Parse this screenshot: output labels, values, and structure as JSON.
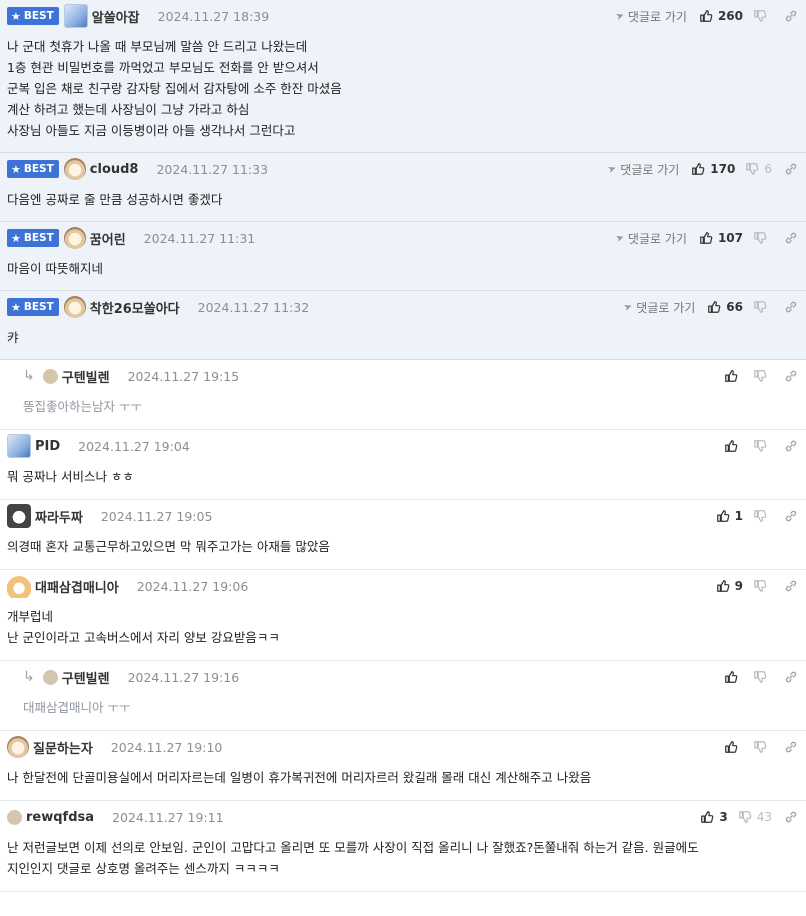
{
  "comments": [
    {
      "best": true,
      "badge": "BEST",
      "avatar": "blue",
      "nick": "알쓸아잡",
      "date": "2024.11.27 18:39",
      "reply_label": "댓글로 가기",
      "up": "260",
      "down": "",
      "lines": [
        "나 군대 첫휴가 나올 때 부모님께 말씀 안 드리고 나왔는데",
        "1층 현관 비밀번호를 까먹었고 부모님도 전화를 안 받으셔서",
        "군복 입은 채로 친구랑 감자탕 집에서 감자탕에 소주 한잔 마셨음",
        "계산 하려고 했는데 사장님이 그냥 가라고 하심",
        "사장님 아들도 지금 이등병이라 아들 생각나서 그런다고"
      ]
    },
    {
      "best": true,
      "badge": "BEST",
      "avatar": "dog",
      "nick": "cloud8",
      "date": "2024.11.27 11:33",
      "reply_label": "댓글로 가기",
      "up": "170",
      "down": "6",
      "lines": [
        "다음엔 공짜로 줄 만큼 성공하시면 좋겠다"
      ]
    },
    {
      "best": true,
      "badge": "BEST",
      "avatar": "dog",
      "nick": "꿈어린",
      "date": "2024.11.27 11:31",
      "reply_label": "댓글로 가기",
      "up": "107",
      "down": "",
      "lines": [
        "마음이 따뜻해지네"
      ]
    },
    {
      "best": true,
      "badge": "BEST",
      "avatar": "dog",
      "nick": "착한26모쏠아다",
      "date": "2024.11.27 11:32",
      "reply_label": "댓글로 가기",
      "up": "66",
      "down": "",
      "lines": [
        "캬"
      ]
    },
    {
      "reply": true,
      "avatar": "dot",
      "nick": "구텐빌렌",
      "date": "2024.11.27 19:15",
      "up": "",
      "down": "",
      "lines": [
        "똥집좋아하는남자 ㅜㅜ"
      ]
    },
    {
      "avatar": "blue",
      "nick": "PID",
      "date": "2024.11.27 19:04",
      "up": "",
      "down": "",
      "lines": [
        "뭐 공짜나 서비스나 ㅎㅎ"
      ]
    },
    {
      "avatar": "dogdark",
      "nick": "짜라두짜",
      "date": "2024.11.27 19:05",
      "up": "1",
      "down": "",
      "lines": [
        "의경때 혼자 교통근무하고있으면 막 뭐주고가는 아재들 많았음"
      ]
    },
    {
      "avatar": "fox",
      "nick": "대패삼겹매니아",
      "date": "2024.11.27 19:06",
      "up": "9",
      "down": "",
      "lines": [
        "개부럽네",
        "난 군인이라고 고속버스에서 자리 양보 강요받음ㅋㅋ"
      ]
    },
    {
      "reply": true,
      "avatar": "dot",
      "nick": "구텐빌렌",
      "date": "2024.11.27 19:16",
      "up": "",
      "down": "",
      "lines": [
        "대패삼겹매니아 ㅜㅜ"
      ]
    },
    {
      "avatar": "dog",
      "nick": "질문하는자",
      "date": "2024.11.27 19:10",
      "up": "",
      "down": "",
      "lines": [
        "나 한달전에 단골미용실에서 머리자르는데 일병이 휴가복귀전에 머리자르러 왔길래 몰래 대신 계산해주고 나왔음"
      ]
    },
    {
      "avatar": "dot",
      "nick": "rewqfdsa",
      "date": "2024.11.27 19:11",
      "up": "3",
      "down": "43",
      "lines": [
        "난 저런글보면 이제 선의로 안보임. 군인이 고맙다고 올리면 또 모를까 사장이 직접 올리니 나 잘했죠?돈쭐내줘 하는거 같음. 원글에도",
        "지인인지 댓글로 상호명 올려주는 센스까지 ㅋㅋㅋㅋ"
      ]
    }
  ],
  "icons": {
    "star": "star-icon",
    "thumb_up": "thumbs-up-icon",
    "thumb_down": "thumbs-down-icon",
    "link": "link-icon",
    "send": "send-icon",
    "reply_arrow": "reply-arrow-icon"
  }
}
